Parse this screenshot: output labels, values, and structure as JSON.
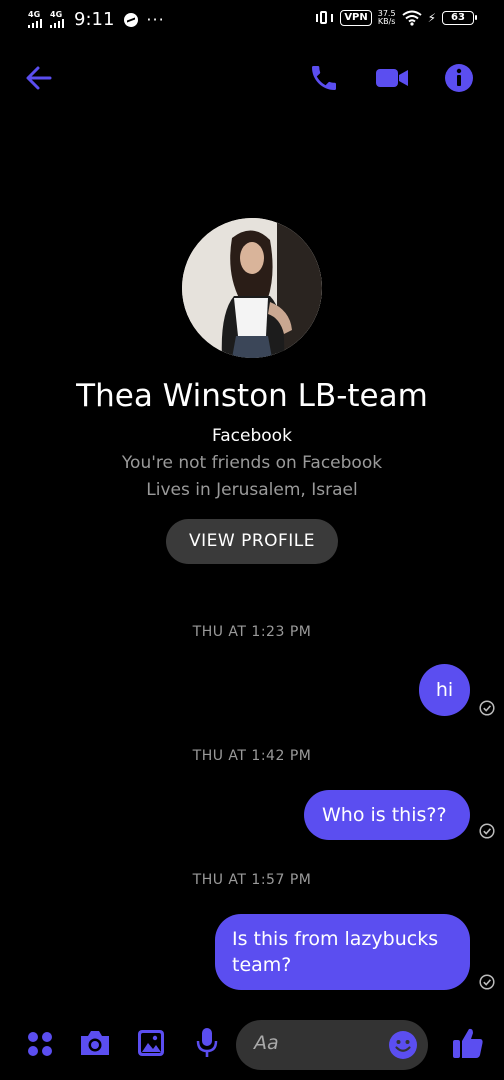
{
  "status_bar": {
    "net1": "4G",
    "net2": "4G",
    "time": "9:11",
    "dots": "···",
    "vpn": "VPN",
    "speed_value": "37.5",
    "speed_unit": "KB/s",
    "battery": "63"
  },
  "contact": {
    "name": "Thea Winston LB-team",
    "source": "Facebook",
    "friend_status": "You're not friends on Facebook",
    "location": "Lives in Jerusalem, Israel",
    "view_profile_label": "VIEW PROFILE"
  },
  "conversation": [
    {
      "timestamp": "THU AT 1:23 PM",
      "message": "hi"
    },
    {
      "timestamp": "THU AT 1:42 PM",
      "message": "Who is this??"
    },
    {
      "timestamp": "THU AT 1:57 PM",
      "message_line1": "Is this from lazybucks",
      "message_line2": "team?"
    }
  ],
  "composer": {
    "placeholder": "Aa"
  },
  "colors": {
    "accent": "#5b4ef0",
    "background": "#000000",
    "secondary_text": "#9a9a9a"
  },
  "icons": [
    "back-arrow-icon",
    "phone-icon",
    "video-camera-icon",
    "info-icon",
    "grid-menu-icon",
    "camera-icon",
    "gallery-icon",
    "microphone-icon",
    "emoji-icon",
    "thumbs-up-icon",
    "seen-check-icon"
  ]
}
